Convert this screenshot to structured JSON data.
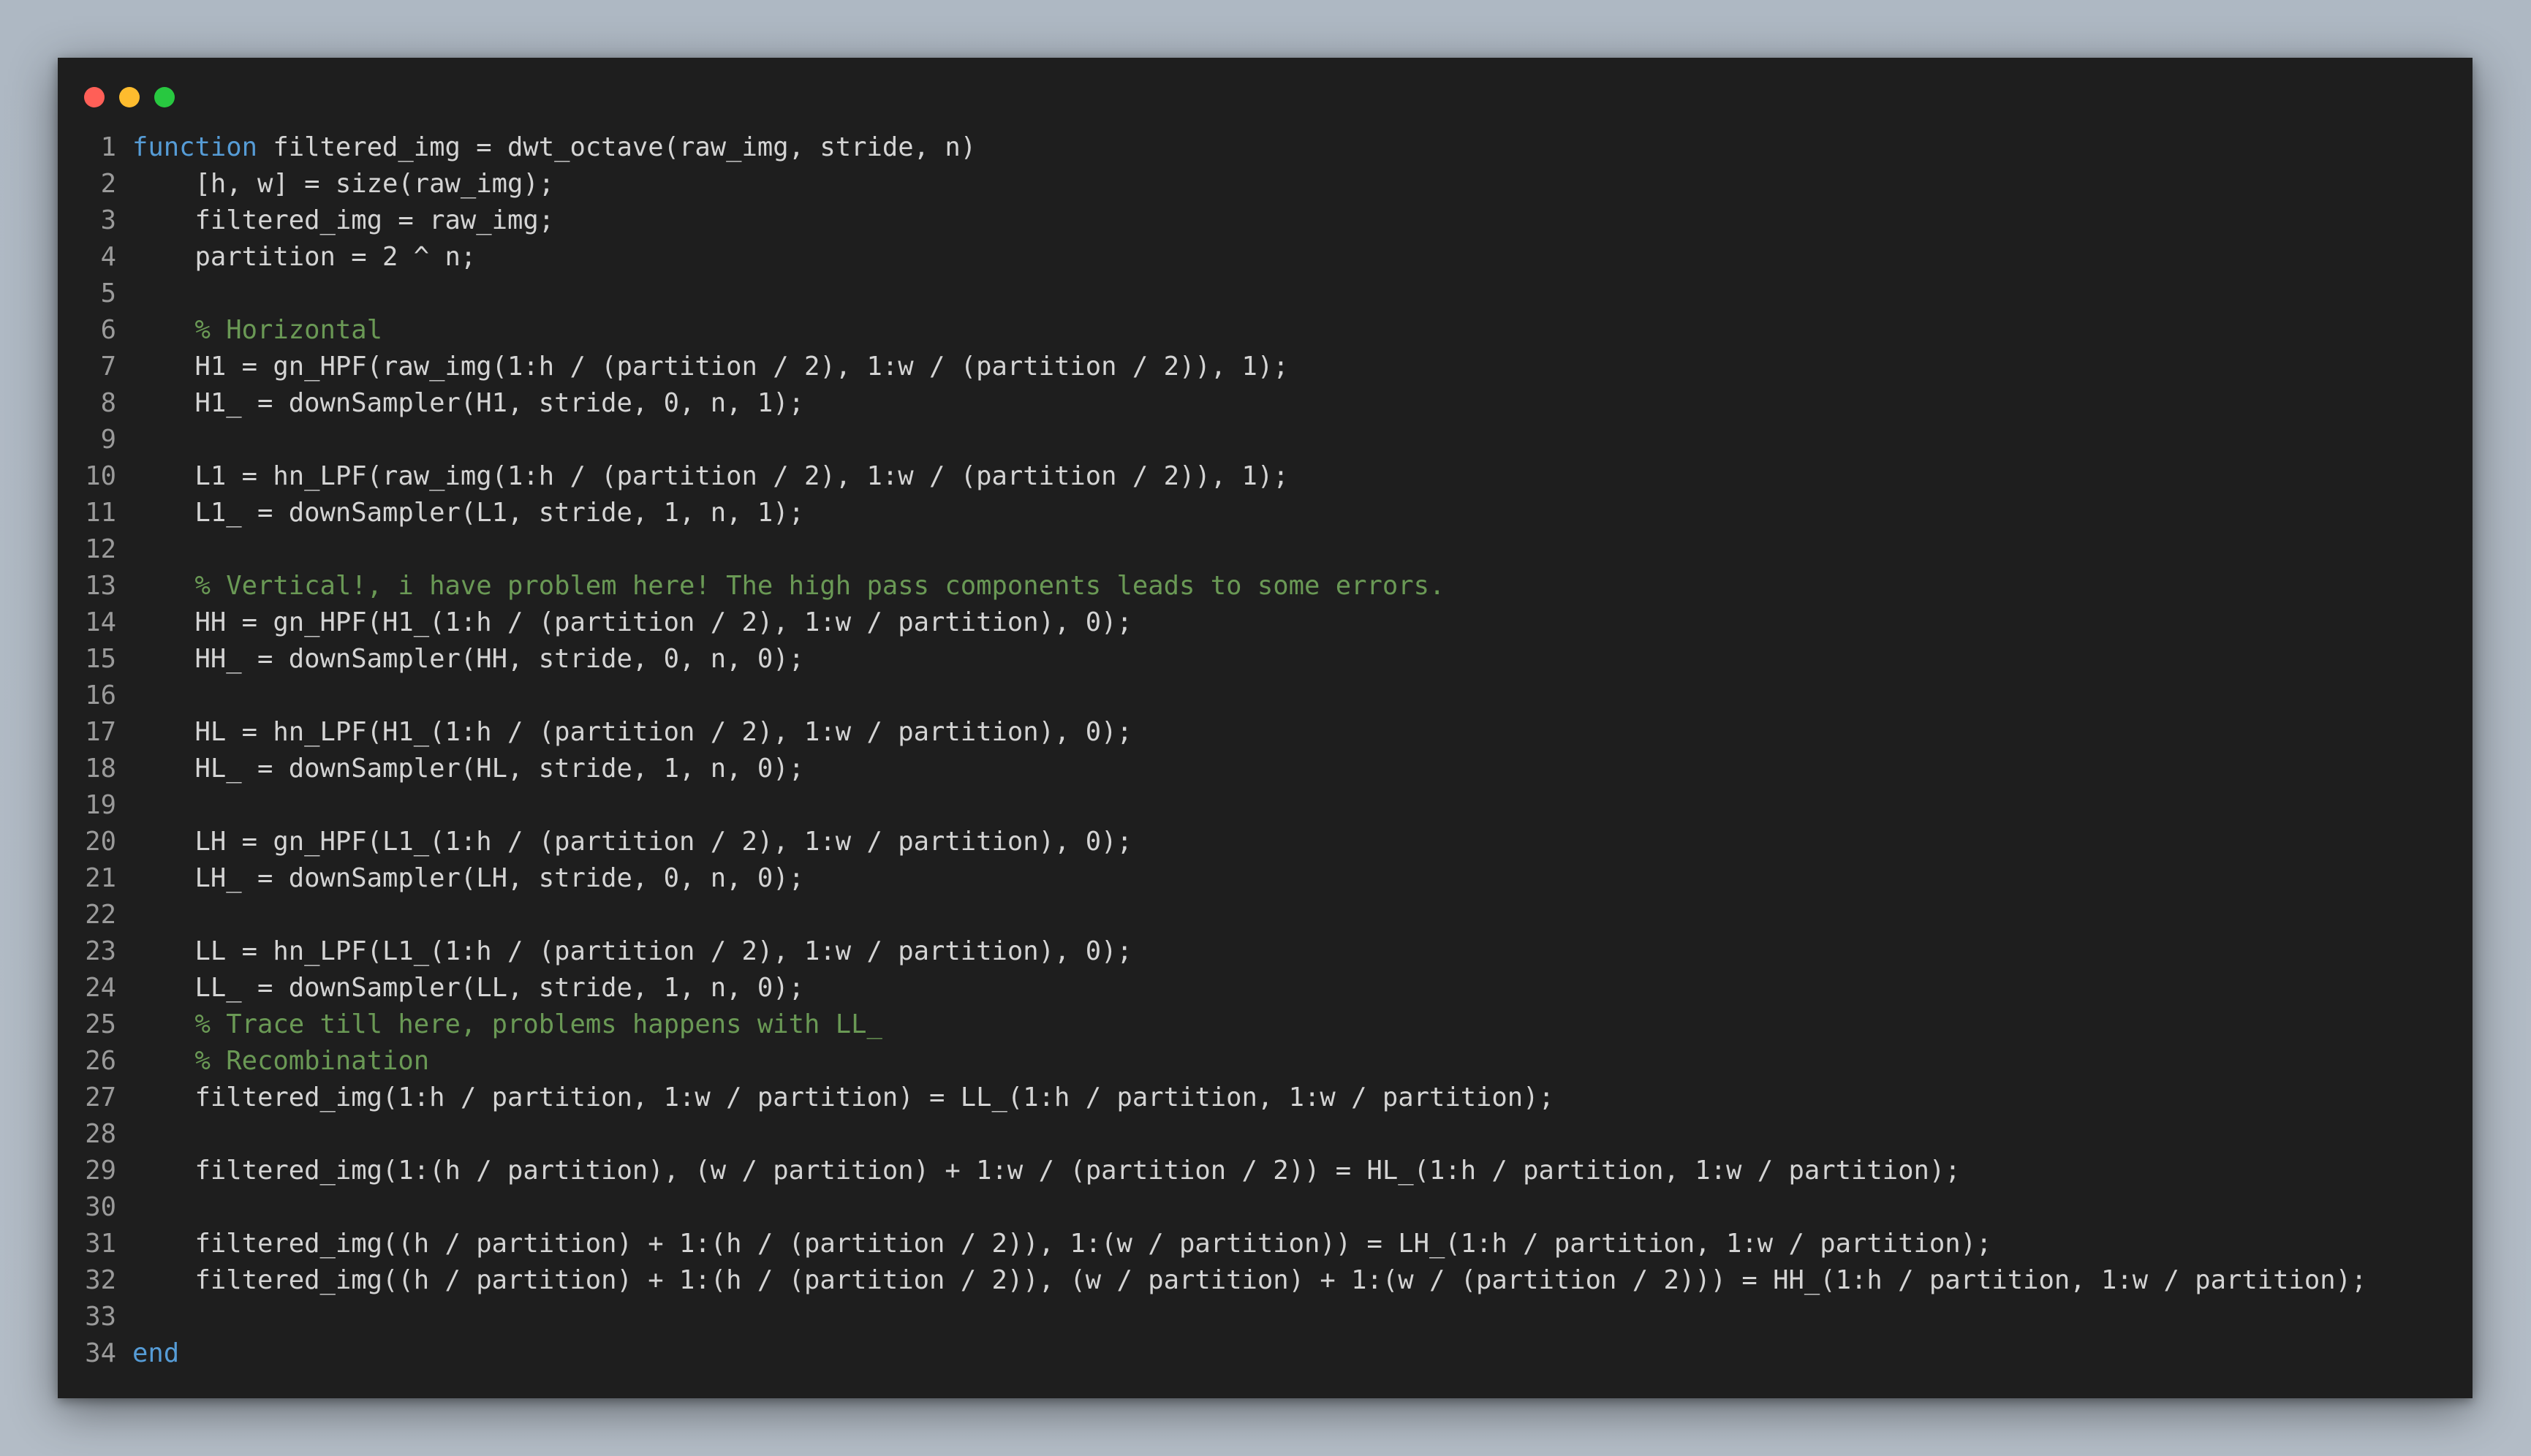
{
  "window": {
    "controls": [
      "close",
      "minimize",
      "maximize"
    ]
  },
  "theme": {
    "background": "#1e1e1e",
    "text": "#d4d4d4",
    "keyword": "#569cd6",
    "comment": "#6a9955",
    "line_number": "#9a9a9a"
  },
  "code_lines": [
    {
      "n": "1",
      "segs": [
        [
          "kw",
          "function"
        ],
        [
          "txt",
          " filtered_img = dwt_octave(raw_img, stride, n)"
        ]
      ]
    },
    {
      "n": "2",
      "segs": [
        [
          "txt",
          "    [h, w] = size(raw_img);"
        ]
      ]
    },
    {
      "n": "3",
      "segs": [
        [
          "txt",
          "    filtered_img = raw_img;"
        ]
      ]
    },
    {
      "n": "4",
      "segs": [
        [
          "txt",
          "    partition = 2 ^ n;"
        ]
      ]
    },
    {
      "n": "5",
      "segs": []
    },
    {
      "n": "6",
      "segs": [
        [
          "txt",
          "    "
        ],
        [
          "cm",
          "% Horizontal"
        ]
      ]
    },
    {
      "n": "7",
      "segs": [
        [
          "txt",
          "    H1 = gn_HPF(raw_img(1:h / (partition / 2), 1:w / (partition / 2)), 1);"
        ]
      ]
    },
    {
      "n": "8",
      "segs": [
        [
          "txt",
          "    H1_ = downSampler(H1, stride, 0, n, 1);"
        ]
      ]
    },
    {
      "n": "9",
      "segs": []
    },
    {
      "n": "10",
      "segs": [
        [
          "txt",
          "    L1 = hn_LPF(raw_img(1:h / (partition / 2), 1:w / (partition / 2)), 1);"
        ]
      ]
    },
    {
      "n": "11",
      "segs": [
        [
          "txt",
          "    L1_ = downSampler(L1, stride, 1, n, 1);"
        ]
      ]
    },
    {
      "n": "12",
      "segs": []
    },
    {
      "n": "13",
      "segs": [
        [
          "txt",
          "    "
        ],
        [
          "cm",
          "% Vertical!, i have problem here! The high pass components leads to some errors."
        ]
      ]
    },
    {
      "n": "14",
      "segs": [
        [
          "txt",
          "    HH = gn_HPF(H1_(1:h / (partition / 2), 1:w / partition), 0);"
        ]
      ]
    },
    {
      "n": "15",
      "segs": [
        [
          "txt",
          "    HH_ = downSampler(HH, stride, 0, n, 0);"
        ]
      ]
    },
    {
      "n": "16",
      "segs": []
    },
    {
      "n": "17",
      "segs": [
        [
          "txt",
          "    HL = hn_LPF(H1_(1:h / (partition / 2), 1:w / partition), 0);"
        ]
      ]
    },
    {
      "n": "18",
      "segs": [
        [
          "txt",
          "    HL_ = downSampler(HL, stride, 1, n, 0);"
        ]
      ]
    },
    {
      "n": "19",
      "segs": []
    },
    {
      "n": "20",
      "segs": [
        [
          "txt",
          "    LH = gn_HPF(L1_(1:h / (partition / 2), 1:w / partition), 0);"
        ]
      ]
    },
    {
      "n": "21",
      "segs": [
        [
          "txt",
          "    LH_ = downSampler(LH, stride, 0, n, 0);"
        ]
      ]
    },
    {
      "n": "22",
      "segs": []
    },
    {
      "n": "23",
      "segs": [
        [
          "txt",
          "    LL = hn_LPF(L1_(1:h / (partition / 2), 1:w / partition), 0);"
        ]
      ]
    },
    {
      "n": "24",
      "segs": [
        [
          "txt",
          "    LL_ = downSampler(LL, stride, 1, n, 0);"
        ]
      ]
    },
    {
      "n": "25",
      "segs": [
        [
          "txt",
          "    "
        ],
        [
          "cm",
          "% Trace till here, problems happens with LL_"
        ]
      ]
    },
    {
      "n": "26",
      "segs": [
        [
          "txt",
          "    "
        ],
        [
          "cm",
          "% Recombination"
        ]
      ]
    },
    {
      "n": "27",
      "segs": [
        [
          "txt",
          "    filtered_img(1:h / partition, 1:w / partition) = LL_(1:h / partition, 1:w / partition);"
        ]
      ]
    },
    {
      "n": "28",
      "segs": []
    },
    {
      "n": "29",
      "segs": [
        [
          "txt",
          "    filtered_img(1:(h / partition), (w / partition) + 1:w / (partition / 2)) = HL_(1:h / partition, 1:w / partition);"
        ]
      ]
    },
    {
      "n": "30",
      "segs": []
    },
    {
      "n": "31",
      "segs": [
        [
          "txt",
          "    filtered_img((h / partition) + 1:(h / (partition / 2)), 1:(w / partition)) = LH_(1:h / partition, 1:w / partition);"
        ]
      ]
    },
    {
      "n": "32",
      "segs": [
        [
          "txt",
          "    filtered_img((h / partition) + 1:(h / (partition / 2)), (w / partition) + 1:(w / (partition / 2))) = HH_(1:h / partition, 1:w / partition);"
        ]
      ]
    },
    {
      "n": "33",
      "segs": []
    },
    {
      "n": "34",
      "segs": [
        [
          "kw",
          "end"
        ]
      ]
    }
  ]
}
